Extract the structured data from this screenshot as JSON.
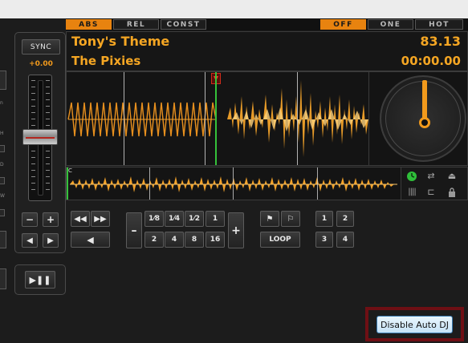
{
  "deck": {
    "title": "Tony's Theme",
    "artist": "The Pixies",
    "bpm": "83.13",
    "time": "00:00.00"
  },
  "modes": {
    "abs": "ABS",
    "rel": "REL",
    "const": "CONST",
    "off": "OFF",
    "one": "ONE",
    "hot": "HOT",
    "active_left": "ABS",
    "active_right": "OFF"
  },
  "pitch": {
    "sync_label": "SYNC",
    "value": "+0.00",
    "fader_level": 0.5
  },
  "loop": {
    "lengths_top": [
      "1⁄8",
      "1⁄4",
      "1⁄2",
      "1"
    ],
    "lengths_bottom": [
      "2",
      "4",
      "8",
      "16"
    ],
    "loop_label": "LOOP",
    "minus_label": "–",
    "plus_label": "+"
  },
  "hotcues": {
    "top": [
      "1",
      "2"
    ],
    "bottom": [
      "3",
      "4"
    ]
  },
  "overview": {
    "cue_letter": "C"
  },
  "left_panel_letters": [
    "n",
    "H",
    "D",
    "W"
  ],
  "autodj": {
    "button_label": "Disable Auto DJ"
  },
  "colors": {
    "accent": "#f5a623",
    "waveform": "#f2a22a",
    "playhead": "#35c23b",
    "cue": "#d12b1b",
    "highlight_frame": "#6e0f14"
  },
  "icons": {
    "jog": "turntable-jog-icon",
    "green_timer": "clock-icon",
    "repeat": "repeat-icon",
    "eject": "eject-icon",
    "bars": "bars-icon",
    "loop_back": "loop-back-icon",
    "lock": "lock-icon"
  }
}
